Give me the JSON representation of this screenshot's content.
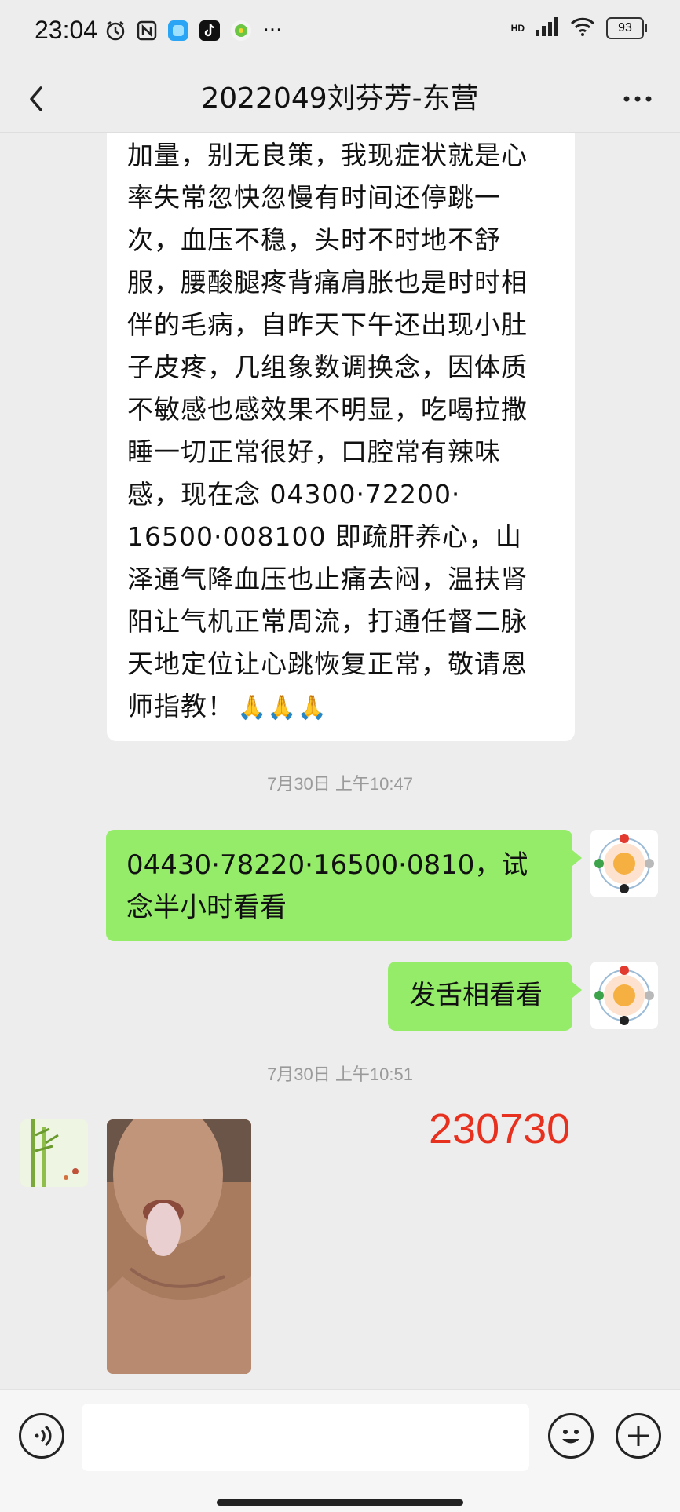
{
  "status_bar": {
    "time": "23:04",
    "network": "HD",
    "battery": "93",
    "more_dots": "···"
  },
  "header": {
    "title": "2022049刘芬芳-东营",
    "back_icon": "chevron-left-icon",
    "more_icon": "more-dots-icon"
  },
  "messages": {
    "incoming_text": "加量，别无良策，我现症状就是心\n率失常忽快忽慢有时间还停跳一\n次，血压不稳，头时不时地不舒\n服，腰酸腿疼背痛肩胀也是时时相\n伴的毛病，自昨天下午还出现小肚\n子皮疼，几组象数调换念，因体质\n不敏感也感效果不明显，吃喝拉撒\n睡一切正常很好，口腔常有辣味\n感，现在念 04300·72200·\n16500·008100 即疏肝养心，山\n泽通气降血压也止痛去闷，温扶肾\n阳让气机正常周流，打通任督二脉\n天地定位让心跳恢复正常，敬请恩\n师指教！",
    "incoming_emoji": "🙏🙏🙏",
    "timestamp_1": "7月30日 上午10:47",
    "outgoing_1": "04430·78220·16500·0810，试念半小时看看",
    "outgoing_2": "发舌相看看",
    "timestamp_2": "7月30日 上午10:51",
    "photo_stamp": "230730"
  },
  "input_bar": {
    "voice_icon": "voice-icon",
    "emoji_icon": "emoji-icon",
    "plus_icon": "plus-icon"
  },
  "colors": {
    "background": "#ededed",
    "outgoing_bubble": "#95ec69",
    "incoming_bubble": "#ffffff",
    "stamp_red": "#e8301f"
  }
}
